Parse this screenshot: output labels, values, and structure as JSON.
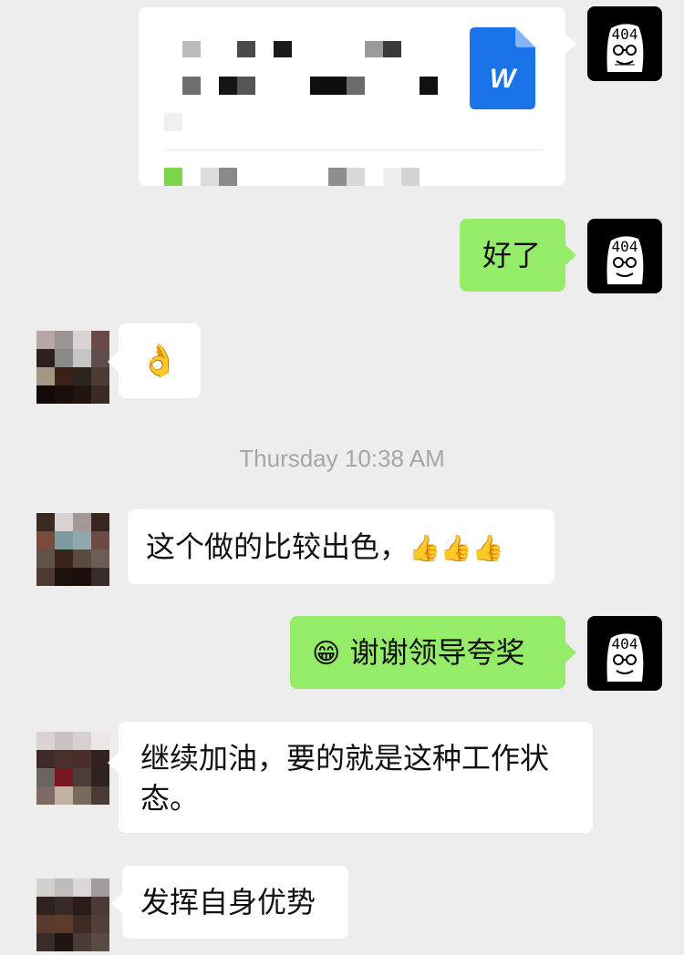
{
  "colors": {
    "background": "#ededed",
    "bubble_self": "#95ec69",
    "bubble_other": "#ffffff",
    "doc_icon": "#1a73e8",
    "timestamp": "#a6a6a6"
  },
  "self_avatar": {
    "label": "404",
    "icon": "cartoon-face-with-glasses"
  },
  "messages": [
    {
      "sender": "self",
      "type": "file",
      "file_icon": "word-document-icon",
      "file_letter": "W",
      "content_obscured": true
    },
    {
      "sender": "self",
      "type": "text",
      "text": "好了"
    },
    {
      "sender": "other",
      "type": "emoji",
      "emoji": "👌"
    },
    {
      "type": "timestamp",
      "text": "Thursday 10:38 AM"
    },
    {
      "sender": "other",
      "type": "text",
      "text": "这个做的比较出色，",
      "emoji": "👍👍👍"
    },
    {
      "sender": "self",
      "type": "text",
      "emoji": "😁",
      "text": "谢谢领导夸奖"
    },
    {
      "sender": "other",
      "type": "text",
      "text": "继续加油，要的就是这种工作状态。"
    },
    {
      "sender": "other",
      "type": "text",
      "text": "发挥自身优势"
    }
  ],
  "other_avatar_tiles": [
    [
      "#b6a7a5",
      "#9a9593",
      "#d9d3d2",
      "#6a4a47"
    ],
    [
      "#2c1f1c",
      "#8a8c8a",
      "#c4c6c3",
      "#5e4e4b"
    ],
    [
      "#a39683",
      "#3a2016",
      "#2d241e",
      "#4c3c34"
    ],
    [
      "#120a08",
      "#1a0e0b",
      "#221410",
      "#3a2a24"
    ]
  ],
  "other_avatar_tiles_2": [
    [
      "#3a2a22",
      "#d9d2d2",
      "#a39797",
      "#3b2520"
    ],
    [
      "#7a4a3a",
      "#7d9aa0",
      "#8ea9ad",
      "#6d4a42"
    ],
    [
      "#5e5346",
      "#3a2318",
      "#5a4a40",
      "#6d5e55"
    ],
    [
      "#4e3a33",
      "#1e120f",
      "#1c0f0d",
      "#3a2d29"
    ]
  ],
  "other_avatar_tiles_3": [
    [
      "#d9d3d2",
      "#c8c2c1",
      "#d6d0cf",
      "#ece6e5"
    ],
    [
      "#3e2a26",
      "#4a2f2b",
      "#4b2e2b",
      "#342220"
    ],
    [
      "#6a6462",
      "#7a1622",
      "#4c3e38",
      "#2f231f"
    ],
    [
      "#7d6b63",
      "#c0b3a4",
      "#7a6a5e",
      "#4a3b34"
    ]
  ],
  "other_avatar_tiles_4": [
    [
      "#d4cfcf",
      "#c0bcbc",
      "#ddd8d8",
      "#a39c9c"
    ],
    [
      "#2e2220",
      "#3a2a27",
      "#2a1c1a",
      "#4a3b37"
    ],
    [
      "#5a3a2c",
      "#5c3b28",
      "#3d2a22",
      "#524038"
    ],
    [
      "#3a2b27",
      "#1f1512",
      "#4b3b35",
      "#5a4a44"
    ]
  ]
}
